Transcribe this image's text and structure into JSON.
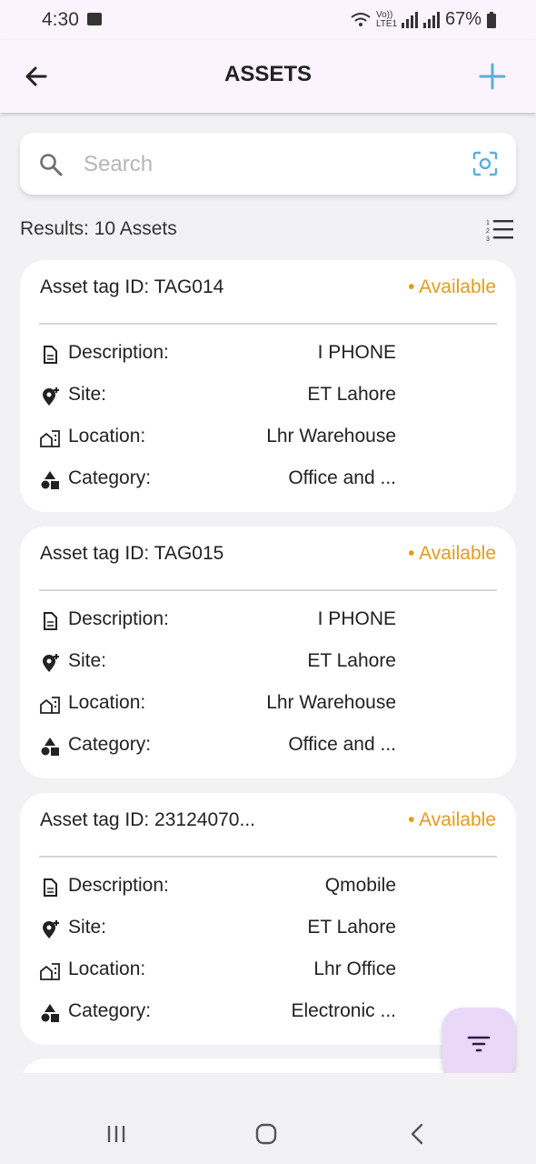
{
  "status_bar": {
    "time": "4:30",
    "network": "Vo)) LTE1",
    "battery": "67%"
  },
  "app_bar": {
    "title": "ASSETS"
  },
  "search": {
    "placeholder": "Search"
  },
  "results": {
    "text": "Results: 10 Assets"
  },
  "labels": {
    "description": "Description:",
    "site": "Site:",
    "location": "Location:",
    "category": "Category:"
  },
  "assets": [
    {
      "tag": "Asset tag ID: TAG014",
      "status": "• Available",
      "description": "I PHONE",
      "site": "ET Lahore",
      "location": "Lhr Warehouse",
      "category": "Office and ..."
    },
    {
      "tag": "Asset tag ID: TAG015",
      "status": "• Available",
      "description": "I PHONE",
      "site": "ET Lahore",
      "location": "Lhr Warehouse",
      "category": "Office and ..."
    },
    {
      "tag": "Asset tag ID: 23124070...",
      "status": "• Available",
      "description": "Qmobile",
      "site": "ET Lahore",
      "location": "Lhr Office",
      "category": "Electronic ..."
    }
  ],
  "colors": {
    "status_available": "#e49b1a",
    "accent": "#5aaee0",
    "fab_bg": "#ead8f8",
    "app_bar_bg": "#fbf3fd"
  },
  "icons": [
    "back-arrow-icon",
    "add-icon",
    "search-icon",
    "scan-icon",
    "sort-list-icon",
    "description-icon",
    "site-pin-icon",
    "location-building-icon",
    "category-shapes-icon",
    "filter-icon"
  ]
}
